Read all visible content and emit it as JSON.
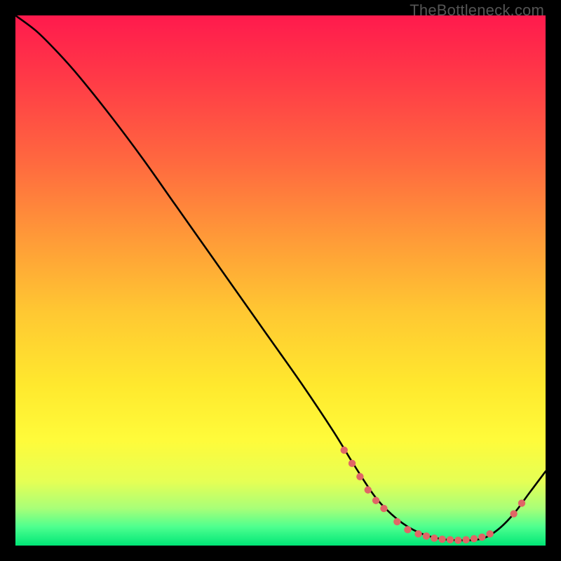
{
  "watermark": "TheBottleneck.com",
  "chart_data": {
    "type": "line",
    "title": "",
    "xlabel": "",
    "ylabel": "",
    "xlim": [
      0,
      100
    ],
    "ylim": [
      0,
      100
    ],
    "grid": false,
    "series": [
      {
        "name": "curve",
        "x": [
          0,
          4,
          8,
          12,
          18,
          24,
          30,
          36,
          42,
          48,
          54,
          60,
          64,
          68,
          72,
          76,
          80,
          84,
          88,
          91,
          94,
          97,
          100
        ],
        "y": [
          100,
          97,
          93,
          88.5,
          81,
          73,
          64.5,
          56,
          47.5,
          39,
          30.5,
          21.5,
          15,
          9,
          5,
          2.5,
          1.3,
          1,
          1.3,
          3,
          6,
          10,
          14
        ]
      }
    ],
    "markers": {
      "name": "highlight-dots",
      "color": "#e06666",
      "points": [
        {
          "x": 62,
          "y": 18
        },
        {
          "x": 63.5,
          "y": 15.5
        },
        {
          "x": 65,
          "y": 13
        },
        {
          "x": 66.5,
          "y": 10.5
        },
        {
          "x": 68,
          "y": 8.5
        },
        {
          "x": 69.5,
          "y": 7
        },
        {
          "x": 72,
          "y": 4.5
        },
        {
          "x": 74,
          "y": 3
        },
        {
          "x": 76,
          "y": 2.2
        },
        {
          "x": 77.5,
          "y": 1.8
        },
        {
          "x": 79,
          "y": 1.4
        },
        {
          "x": 80.5,
          "y": 1.2
        },
        {
          "x": 82,
          "y": 1.1
        },
        {
          "x": 83.5,
          "y": 1.0
        },
        {
          "x": 85,
          "y": 1.1
        },
        {
          "x": 86.5,
          "y": 1.3
        },
        {
          "x": 88,
          "y": 1.6
        },
        {
          "x": 89.5,
          "y": 2.2
        },
        {
          "x": 94,
          "y": 6
        },
        {
          "x": 95.5,
          "y": 8
        }
      ]
    },
    "gradient_stops": [
      {
        "offset": 0.0,
        "color": "#ff1a4d"
      },
      {
        "offset": 0.12,
        "color": "#ff3a47"
      },
      {
        "offset": 0.28,
        "color": "#ff6a3f"
      },
      {
        "offset": 0.42,
        "color": "#ff9a38"
      },
      {
        "offset": 0.56,
        "color": "#ffc832"
      },
      {
        "offset": 0.7,
        "color": "#ffe92e"
      },
      {
        "offset": 0.8,
        "color": "#fffb3a"
      },
      {
        "offset": 0.88,
        "color": "#e5ff55"
      },
      {
        "offset": 0.93,
        "color": "#a8ff78"
      },
      {
        "offset": 0.965,
        "color": "#4dff8f"
      },
      {
        "offset": 1.0,
        "color": "#00e676"
      }
    ]
  }
}
